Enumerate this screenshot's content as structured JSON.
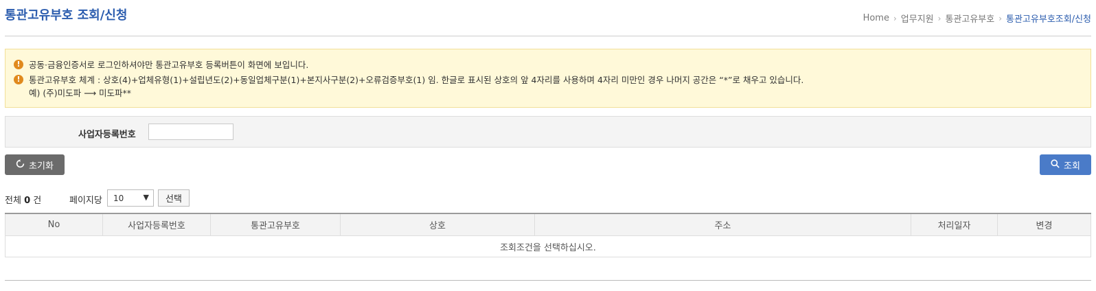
{
  "header": {
    "title": "통관고유부호 조회/신청",
    "breadcrumb": [
      "Home",
      "업무지원",
      "통관고유부호",
      "통관고유부호조회/신청"
    ]
  },
  "notice": {
    "line1": "공동·금융인증서로 로그인하셔야만 통관고유부호 등록버튼이 화면에 보입니다.",
    "line2": "통관고유부호 체계 : 상호(4)+업체유형(1)+설립년도(2)+동일업체구분(1)+본지사구분(2)+오류검증부호(1) 임. 한글로 표시된 상호의 앞 4자리를 사용하며 4자리 미만인 경우 나머지 공간은 “*”로 채우고 있습니다.",
    "line3": "예) (주)미도파 ⟶ 미도파**"
  },
  "search": {
    "label": "사업자등록번호",
    "value": ""
  },
  "buttons": {
    "reset": "초기화",
    "search": "조회",
    "select": "선택"
  },
  "list": {
    "total_prefix": "전체",
    "total_count": "0",
    "total_suffix": "건",
    "perpage_label": "페이지당",
    "perpage_value": "10"
  },
  "table": {
    "headers": [
      "No",
      "사업자등록번호",
      "통관고유부호",
      "상호",
      "주소",
      "처리일자",
      "변경"
    ],
    "empty_message": "조회조건을 선택하십시오."
  },
  "colors": {
    "accent": "#2b5cae",
    "search_button": "#4a7bc8",
    "reset_button": "#6b6b6b",
    "notice_bg": "#fff9d9"
  }
}
